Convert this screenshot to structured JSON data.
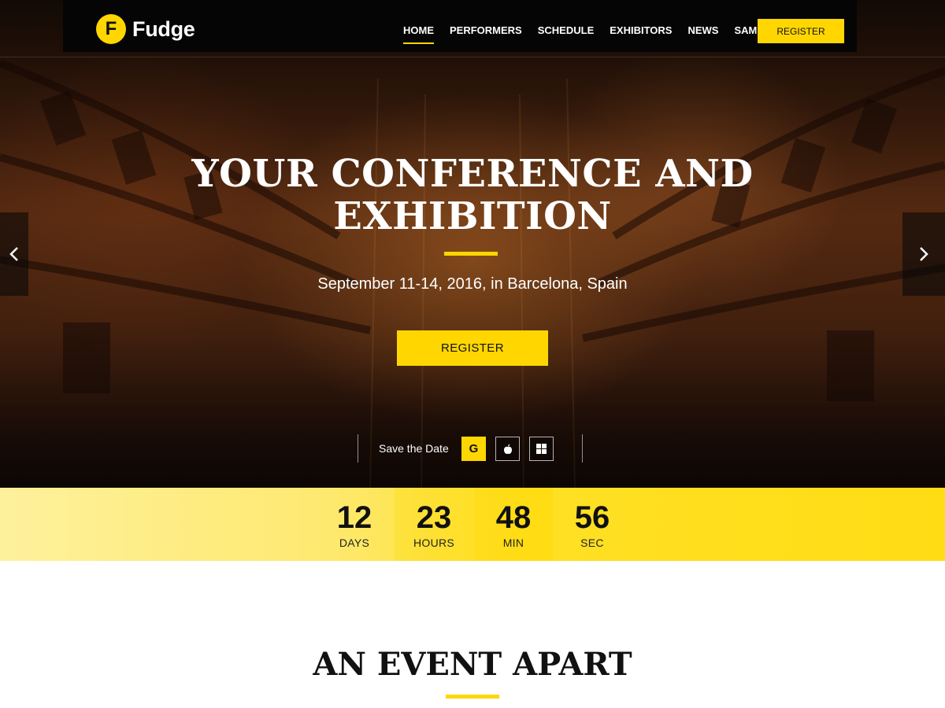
{
  "header": {
    "logo_letter": "F",
    "logo_text": "Fudge",
    "nav": [
      {
        "label": "HOME",
        "active": true
      },
      {
        "label": "PERFORMERS",
        "active": false
      },
      {
        "label": "SCHEDULE",
        "active": false
      },
      {
        "label": "EXHIBITORS",
        "active": false
      },
      {
        "label": "NEWS",
        "active": false
      },
      {
        "label": "SAMPLE",
        "active": false
      }
    ],
    "register_label": "REGISTER"
  },
  "hero": {
    "title_line1": "YOUR CONFERENCE AND",
    "title_line2": "EXHIBITION",
    "subtitle": "September 11-14, 2016, in Barcelona, Spain",
    "register_label": "REGISTER",
    "save_date_label": "Save the Date",
    "calendar_icons": [
      "google-calendar-icon",
      "apple-calendar-icon",
      "windows-calendar-icon"
    ],
    "google_letter": "G"
  },
  "countdown": [
    {
      "value": "12",
      "unit": "DAYS"
    },
    {
      "value": "23",
      "unit": "HOURS"
    },
    {
      "value": "48",
      "unit": "MIN"
    },
    {
      "value": "56",
      "unit": "SEC"
    }
  ],
  "section": {
    "title": "AN EVENT APART"
  },
  "colors": {
    "accent": "#ffd600",
    "header_bg": "#050505",
    "text_dark": "#111111"
  }
}
